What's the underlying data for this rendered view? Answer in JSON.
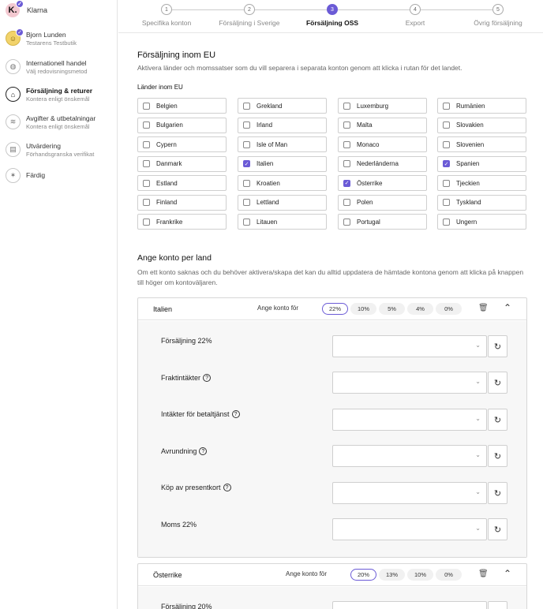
{
  "sidebar": {
    "brand": {
      "logo": "K.",
      "name": "Klarna"
    },
    "items": [
      {
        "icon": "user-avatar-icon",
        "title": "Bjorn Lunden",
        "subtitle": "Testarens Testbutik"
      },
      {
        "icon": "globe-icon",
        "title": "Internationell handel",
        "subtitle": "Välj redovisningsmetod"
      },
      {
        "icon": "bag-icon",
        "title": "Försäljning & returer",
        "subtitle": "Kontera enligt önskemål"
      },
      {
        "icon": "coins-icon",
        "title": "Avgifter & utbetalningar",
        "subtitle": "Kontera enligt önskemål"
      },
      {
        "icon": "document-icon",
        "title": "Utvärdering",
        "subtitle": "Förhandsgranska verifikat"
      },
      {
        "icon": "party-icon",
        "title": "Färdig",
        "subtitle": ""
      }
    ]
  },
  "stepper": {
    "steps": [
      {
        "num": "1",
        "label": "Specifika konton"
      },
      {
        "num": "2",
        "label": "Försäljning i Sverige"
      },
      {
        "num": "3",
        "label": "Försäljning OSS"
      },
      {
        "num": "4",
        "label": "Export"
      },
      {
        "num": "5",
        "label": "Övrig försäljning"
      }
    ],
    "active_index": 2
  },
  "eu_section": {
    "title": "Försäljning inom EU",
    "description": "Aktivera länder och momssatser som du vill separera i separata konton genom att klicka i rutan för det landet.",
    "countries_label": "Länder inom EU",
    "columns": [
      [
        {
          "name": "Belgien",
          "checked": false
        },
        {
          "name": "Bulgarien",
          "checked": false
        },
        {
          "name": "Cypern",
          "checked": false
        },
        {
          "name": "Danmark",
          "checked": false
        },
        {
          "name": "Estland",
          "checked": false
        },
        {
          "name": "Finland",
          "checked": false
        },
        {
          "name": "Frankrike",
          "checked": false
        }
      ],
      [
        {
          "name": "Grekland",
          "checked": false
        },
        {
          "name": "Irland",
          "checked": false
        },
        {
          "name": "Isle of Man",
          "checked": false
        },
        {
          "name": "Italien",
          "checked": true
        },
        {
          "name": "Kroatien",
          "checked": false
        },
        {
          "name": "Lettland",
          "checked": false
        },
        {
          "name": "Litauen",
          "checked": false
        }
      ],
      [
        {
          "name": "Luxemburg",
          "checked": false
        },
        {
          "name": "Malta",
          "checked": false
        },
        {
          "name": "Monaco",
          "checked": false
        },
        {
          "name": "Nederländerna",
          "checked": false
        },
        {
          "name": "Österrike",
          "checked": true
        },
        {
          "name": "Polen",
          "checked": false
        },
        {
          "name": "Portugal",
          "checked": false
        }
      ],
      [
        {
          "name": "Rumänien",
          "checked": false
        },
        {
          "name": "Slovakien",
          "checked": false
        },
        {
          "name": "Slovenien",
          "checked": false
        },
        {
          "name": "Spanien",
          "checked": true
        },
        {
          "name": "Tjeckien",
          "checked": false
        },
        {
          "name": "Tyskland",
          "checked": false
        },
        {
          "name": "Ungern",
          "checked": false
        }
      ]
    ]
  },
  "account_section": {
    "title": "Ange konto per land",
    "description": "Om ett konto saknas och du behöver aktivera/skapa det kan du alltid uppdatera de hämtade kontona genom att klicka på knappen till höger om kontoväljaren.",
    "rates_label": "Ange konto för",
    "italy": {
      "name": "Italien",
      "rates": [
        "22%",
        "10%",
        "5%",
        "4%",
        "0%"
      ],
      "active_rate": "22%",
      "rows": [
        {
          "label": "Försäljning 22%",
          "help": false,
          "value": ""
        },
        {
          "label": "Fraktintäkter",
          "help": true,
          "value": ""
        },
        {
          "label": "Intäkter för betaltjänst",
          "help": true,
          "value": ""
        },
        {
          "label": "Avrundning",
          "help": true,
          "value": ""
        },
        {
          "label": "Köp av presentkort",
          "help": true,
          "value": ""
        },
        {
          "label": "Moms 22%",
          "help": false,
          "value": ""
        }
      ]
    },
    "austria": {
      "name": "Österrike",
      "rates": [
        "20%",
        "13%",
        "10%",
        "0%"
      ],
      "active_rate": "20%",
      "rows": [
        {
          "label": "Försäljning 20%",
          "help": false,
          "value": ""
        }
      ]
    }
  }
}
